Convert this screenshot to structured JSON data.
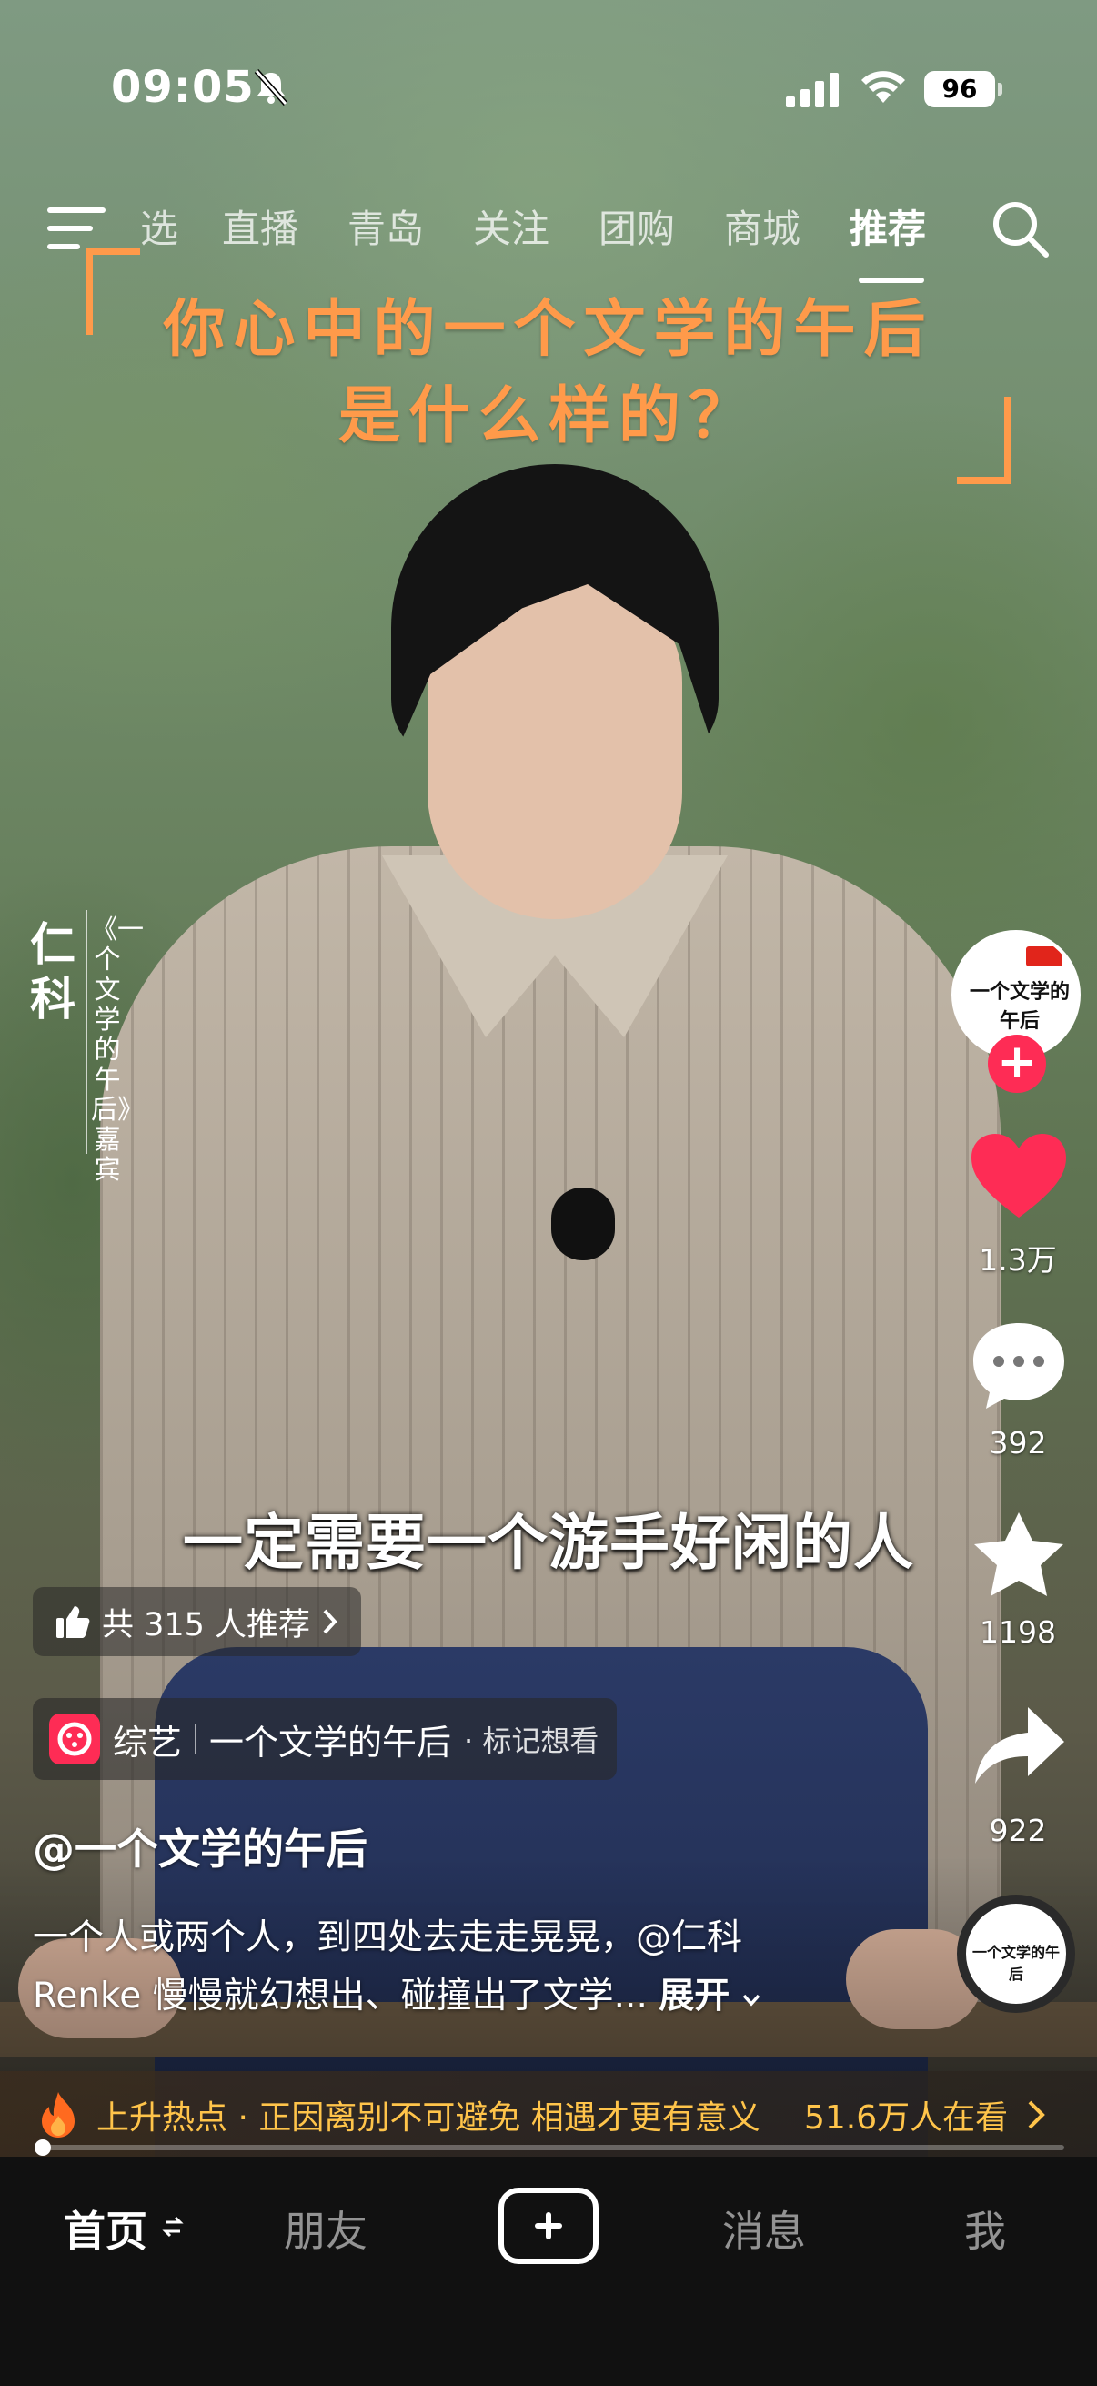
{
  "status_bar": {
    "time": "09:05",
    "battery": "96"
  },
  "top_nav": {
    "tabs": [
      "选",
      "直播",
      "青岛",
      "关注",
      "团购",
      "商城",
      "推荐"
    ],
    "active_tab": "推荐"
  },
  "video": {
    "headline_line1": "你心中的一个文学的午后",
    "headline_line2": "是什么样的？",
    "guest_name": "仁科",
    "guest_role": "《一个文学的午后》嘉宾",
    "subtitle": "一定需要一个游手好闲的人"
  },
  "actions": {
    "avatar_text": "一个文学的午后",
    "likes": "1.3万",
    "comments": "392",
    "favorites": "1198",
    "shares": "922"
  },
  "info": {
    "recommend_text": "共 315 人推荐",
    "tag_category": "综艺",
    "tag_title": "一个文学的午后",
    "tag_action": "· 标记想看",
    "author": "@一个文学的午后",
    "desc_line1": "一个人或两个人，到四处去走走晃晃，@仁科",
    "desc_line2": "Renke 慢慢就幻想出、碰撞出了文学...",
    "desc_expand": "展开",
    "hot_title": "上升热点 · 正因离别不可避免 相遇才更有意义",
    "hot_count": "51.6万人在看",
    "progress": 0.01
  },
  "tabbar": {
    "home": "首页",
    "friends": "朋友",
    "messages": "消息",
    "me": "我"
  },
  "colors": {
    "accent": "#fe2c55",
    "headline": "#ff9a4a",
    "hot": "#ffc44a"
  }
}
